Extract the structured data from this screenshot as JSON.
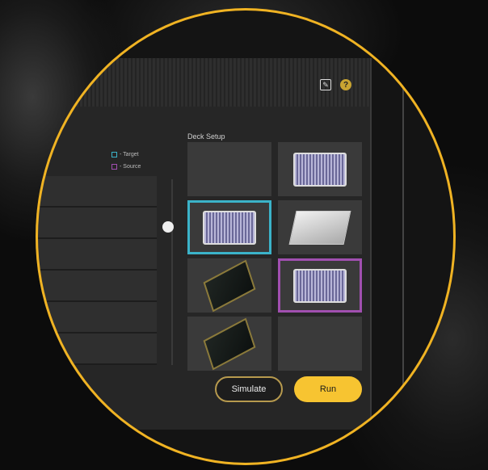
{
  "header": {
    "edit_icon": "pencil-icon",
    "help_icon": "?",
    "help_color": "#c9a431"
  },
  "legend": {
    "target_label": "- Target",
    "target_color": "#3bb3c9",
    "source_label": "- Source",
    "source_color": "#a14fb0"
  },
  "deck": {
    "title": "Deck Setup",
    "slots": [
      "empty",
      "plate",
      "plate-target",
      "reservoir",
      "tips",
      "plate-source",
      "tips",
      "empty"
    ]
  },
  "table": {
    "rows": 6
  },
  "actions": {
    "simulate_label": "Simulate",
    "run_label": "Run",
    "run_color": "#f7c431"
  }
}
